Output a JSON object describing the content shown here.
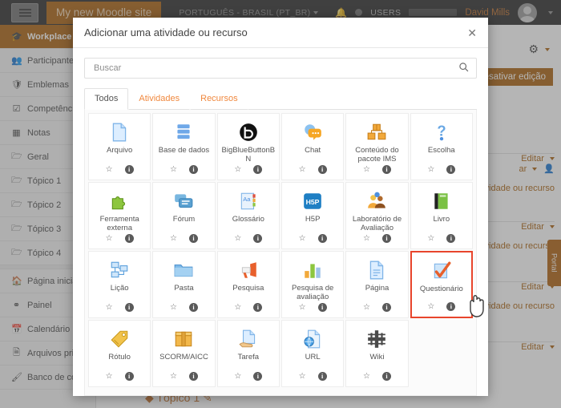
{
  "navbar": {
    "burger_icon": "hamburger-icon",
    "site_name": "My new Moodle site",
    "language": "PORTUGUÊS - BRASIL (PT_BR)",
    "bell_icon": "bell-icon",
    "messages_icon": "message-icon",
    "users_label": "USERS",
    "user_name": "David Mills",
    "avatar_icon": "user-avatar-icon",
    "caret_icon": "chevron-down-icon"
  },
  "sidebar": {
    "items": [
      {
        "label": "Workplace",
        "icon": "graduation-cap-icon",
        "active": true
      },
      {
        "label": "Participantes",
        "icon": "users-icon",
        "active": false
      },
      {
        "label": "Emblemas",
        "icon": "shield-icon",
        "active": false
      },
      {
        "label": "Competências",
        "icon": "checkbox-icon",
        "active": false
      },
      {
        "label": "Notas",
        "icon": "grid-table-icon",
        "active": false
      },
      {
        "label": "Geral",
        "icon": "folder-icon",
        "active": false
      },
      {
        "label": "Tópico 1",
        "icon": "folder-icon",
        "active": false
      },
      {
        "label": "Tópico 2",
        "icon": "folder-icon",
        "active": false
      },
      {
        "label": "Tópico 3",
        "icon": "folder-icon",
        "active": false
      },
      {
        "label": "Tópico 4",
        "icon": "folder-icon",
        "active": false
      },
      {
        "label": "Página inicial",
        "icon": "home-icon",
        "active": false
      },
      {
        "label": "Painel",
        "icon": "dashboard-icon",
        "active": false
      },
      {
        "label": "Calendário",
        "icon": "calendar-icon",
        "active": false
      },
      {
        "label": "Arquivos privados",
        "icon": "file-icon",
        "active": false
      },
      {
        "label": "Banco de conteúdo",
        "icon": "brush-icon",
        "active": false
      }
    ]
  },
  "page": {
    "gear_icon": "gear-icon",
    "edit_button": "Desativar edição",
    "editar_label": "Editar",
    "add_resource_label": "Adicionar uma atividade ou recurso",
    "person_icon": "person-icon",
    "portal_tab": "Portal",
    "topic_bottom": "Tópico 1"
  },
  "modal": {
    "title": "Adicionar uma atividade ou recurso",
    "close_icon": "close-icon",
    "search": {
      "placeholder": "Buscar",
      "value": "",
      "icon": "search-icon"
    },
    "tabs": [
      {
        "label": "Todos",
        "active": true
      },
      {
        "label": "Atividades",
        "active": false
      },
      {
        "label": "Recursos",
        "active": false
      }
    ],
    "star_icon": "star-outline-icon",
    "info_icon": "info-icon",
    "info_glyph": "i",
    "star_glyph": "☆",
    "selected_tile": "Questionário",
    "selection_color": "#e8452c",
    "tiles": [
      {
        "label": "Arquivo",
        "icon": "file-page-icon",
        "selected": false
      },
      {
        "label": "Base de dados",
        "icon": "database-icon",
        "selected": false
      },
      {
        "label": "BigBlueButtonBN",
        "icon": "bigbluebutton-icon",
        "selected": false
      },
      {
        "label": "Chat",
        "icon": "chat-bubble-icon",
        "selected": false
      },
      {
        "label": "Conteúdo do pacote IMS",
        "icon": "ims-package-icon",
        "selected": false
      },
      {
        "label": "Escolha",
        "icon": "question-mark-icon",
        "selected": false
      },
      {
        "label": "Ferramenta externa",
        "icon": "puzzle-piece-icon",
        "selected": false
      },
      {
        "label": "Fórum",
        "icon": "forum-icon",
        "selected": false
      },
      {
        "label": "Glossário",
        "icon": "glossary-icon",
        "selected": false
      },
      {
        "label": "H5P",
        "icon": "h5p-icon",
        "selected": false
      },
      {
        "label": "Laboratório de Avaliação",
        "icon": "workshop-icon",
        "selected": false
      },
      {
        "label": "Livro",
        "icon": "book-icon",
        "selected": false
      },
      {
        "label": "Lição",
        "icon": "lesson-flowchart-icon",
        "selected": false
      },
      {
        "label": "Pasta",
        "icon": "folder-icon",
        "selected": false
      },
      {
        "label": "Pesquisa",
        "icon": "megaphone-icon",
        "selected": false
      },
      {
        "label": "Pesquisa de avaliação",
        "icon": "bar-chart-icon",
        "selected": false
      },
      {
        "label": "Página",
        "icon": "page-icon",
        "selected": false
      },
      {
        "label": "Questionário",
        "icon": "quiz-checkmark-icon",
        "selected": true
      },
      {
        "label": "Rótulo",
        "icon": "label-tag-icon",
        "selected": false
      },
      {
        "label": "SCORM/AICC",
        "icon": "scorm-box-icon",
        "selected": false
      },
      {
        "label": "Tarefa",
        "icon": "assignment-hand-icon",
        "selected": false
      },
      {
        "label": "URL",
        "icon": "url-globe-icon",
        "selected": false
      },
      {
        "label": "Wiki",
        "icon": "wiki-icon",
        "selected": false
      }
    ]
  },
  "colors": {
    "brand_orange": "#a9620f",
    "tab_orange": "#f0883e",
    "selection_red": "#e8452c",
    "navbar_dark": "#2b2b2b"
  }
}
